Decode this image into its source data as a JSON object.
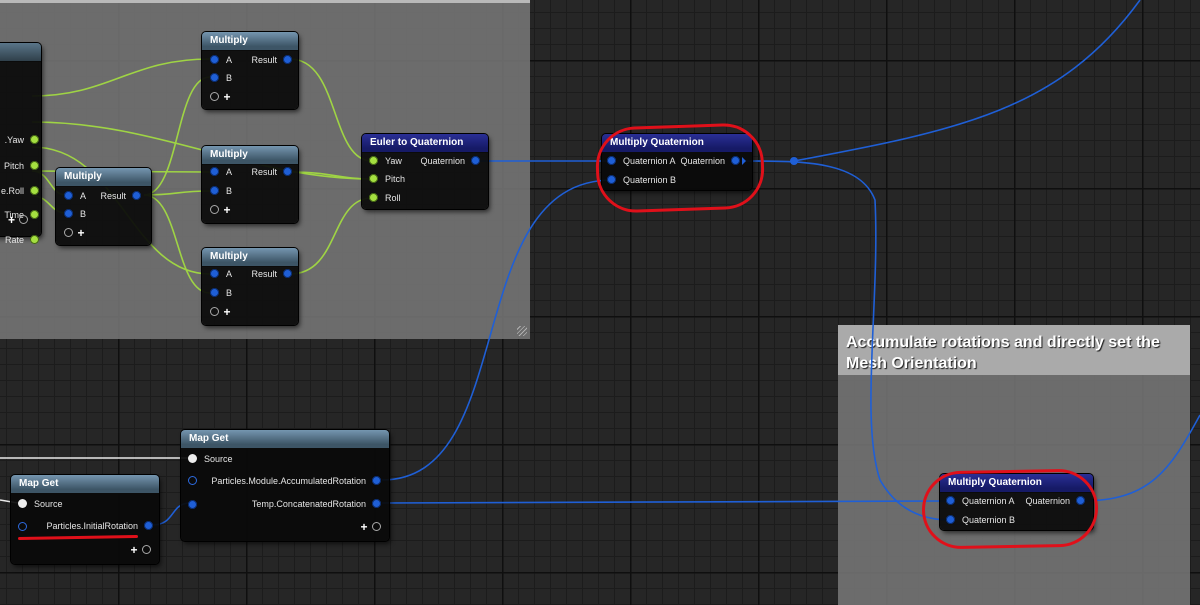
{
  "comment_accumulate": {
    "title": "Accumulate rotations and directly set the Mesh Orientation"
  },
  "left_node": {
    "pins": [
      ".Yaw",
      "Pitch",
      "e.Roll",
      "Time",
      "Rate"
    ]
  },
  "multiply_1": {
    "title": "Multiply",
    "in_a": "A",
    "in_b": "B",
    "out": "Result",
    "add_pin": "+"
  },
  "multiply_2": {
    "title": "Multiply",
    "in_a": "A",
    "in_b": "B",
    "out": "Result",
    "add_pin": "+"
  },
  "multiply_3": {
    "title": "Multiply",
    "in_a": "A",
    "in_b": "B",
    "out": "Result",
    "add_pin": "+"
  },
  "multiply_4": {
    "title": "Multiply",
    "in_a": "A",
    "in_b": "B",
    "out": "Result",
    "add_pin": "+"
  },
  "euler_node": {
    "title": "Euler to Quaternion",
    "yaw": "Yaw",
    "pitch": "Pitch",
    "roll": "Roll",
    "out": "Quaternion"
  },
  "mul_quat_1": {
    "title": "Multiply Quaternion",
    "in_a": "Quaternion A",
    "in_b": "Quaternion B",
    "out": "Quaternion"
  },
  "mul_quat_2": {
    "title": "Multiply Quaternion",
    "in_a": "Quaternion A",
    "in_b": "Quaternion B",
    "out": "Quaternion"
  },
  "map_get_1": {
    "title": "Map Get",
    "source": "Source",
    "out": "Particles.InitialRotation",
    "add_pin": "+"
  },
  "map_get_2": {
    "title": "Map Get",
    "source": "Source",
    "out_1": "Particles.Module.AccumulatedRotation",
    "out_2": "Temp.ConcatenatedRotation",
    "add_pin": "+"
  },
  "colors": {
    "float_pin": "#a5e040",
    "quaternion_pin": "#1f5fd6",
    "annotation_red": "#e0101a",
    "header_default": "#5a7589",
    "header_quaternion": "#1e2280"
  }
}
